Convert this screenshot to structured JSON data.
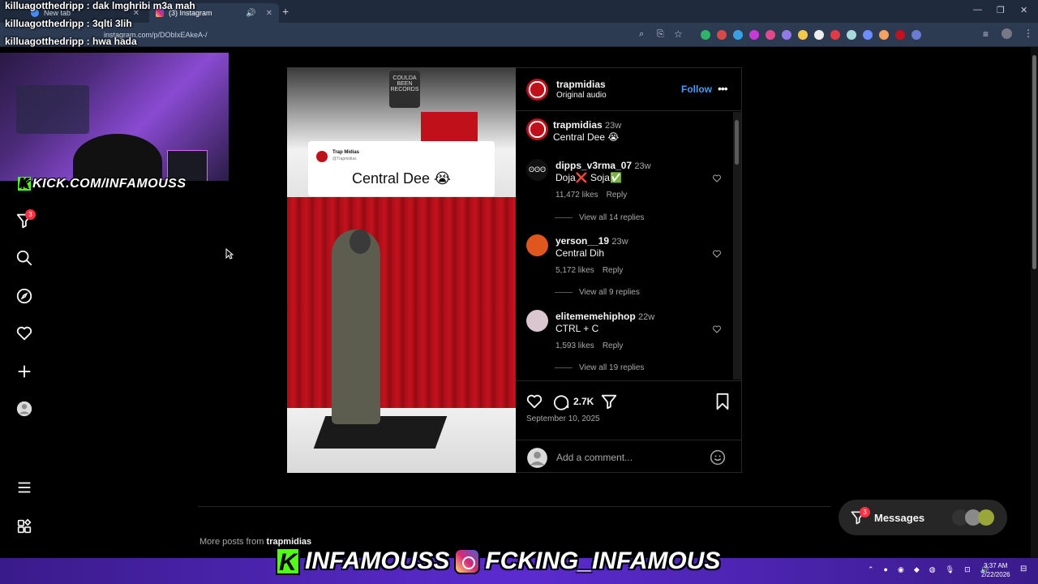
{
  "browser": {
    "tabs": [
      {
        "label": "New tab",
        "active": false
      },
      {
        "label": "(3) Instagram",
        "active": true
      }
    ],
    "url": "instagram.com/p/DObIxEAkeA-/",
    "extension_icons": [
      "extension-1",
      "extension-2",
      "extension-3",
      "extension-4",
      "extension-5",
      "extension-6",
      "extension-7",
      "extension-8",
      "extension-9",
      "extension-10",
      "extension-11",
      "extension-12",
      "extension-13",
      "extension-14"
    ]
  },
  "chat_overlay": [
    {
      "text": "killuagotthedripp : dak lmghribi m3a mah"
    },
    {
      "text": "killuagotthedripp : 3qlti 3lih"
    },
    {
      "text": "killuagotthedripp : hwa hada"
    }
  ],
  "stream": {
    "kick_label": "KICK.COM/INFAMOUSS",
    "brand_kick": "INFAMOUSS",
    "brand_ig": "FCKING_INFAMOUS"
  },
  "nav": {
    "notifications_badge": "3"
  },
  "post": {
    "author": "trapmidias",
    "audio": "Original audio",
    "follow_label": "Follow",
    "tweet": {
      "name": "Trap Midias",
      "handle": "@Trapmidias",
      "text": "Central Dee 😭"
    },
    "media_sign": "COULDA BEEN RECORDS",
    "caption": {
      "user": "trapmidias",
      "time": "23w",
      "text": "Central Dee 😭"
    },
    "comments": [
      {
        "user": "dipps_v3rma_07",
        "time": "23w",
        "text": "Doja❌ Soja✅",
        "likes": "11,472 likes",
        "reply": "Reply",
        "replies": "View all 14 replies"
      },
      {
        "user": "yerson__19",
        "time": "23w",
        "text": "Central Dih",
        "likes": "5,172 likes",
        "reply": "Reply",
        "replies": "View all 9 replies"
      },
      {
        "user": "elitememehiphop",
        "time": "22w",
        "text": "CTRL + C",
        "likes": "1,593 likes",
        "reply": "Reply",
        "replies": "View all 19 replies"
      }
    ],
    "comment_count": "2.7K",
    "date": "September 10, 2025",
    "add_comment_placeholder": "Add a comment..."
  },
  "more_posts": {
    "prefix": "More posts from ",
    "user": "trapmidias"
  },
  "messages": {
    "label": "Messages",
    "badge": "3"
  },
  "taskbar": {
    "time": "3:37 AM",
    "date": "2/22/2026"
  },
  "colors": {
    "accent": "#4a9bf5",
    "badge": "#ff3040",
    "kick_green": "#53fc18",
    "taskbar": "#5b2bd0"
  }
}
